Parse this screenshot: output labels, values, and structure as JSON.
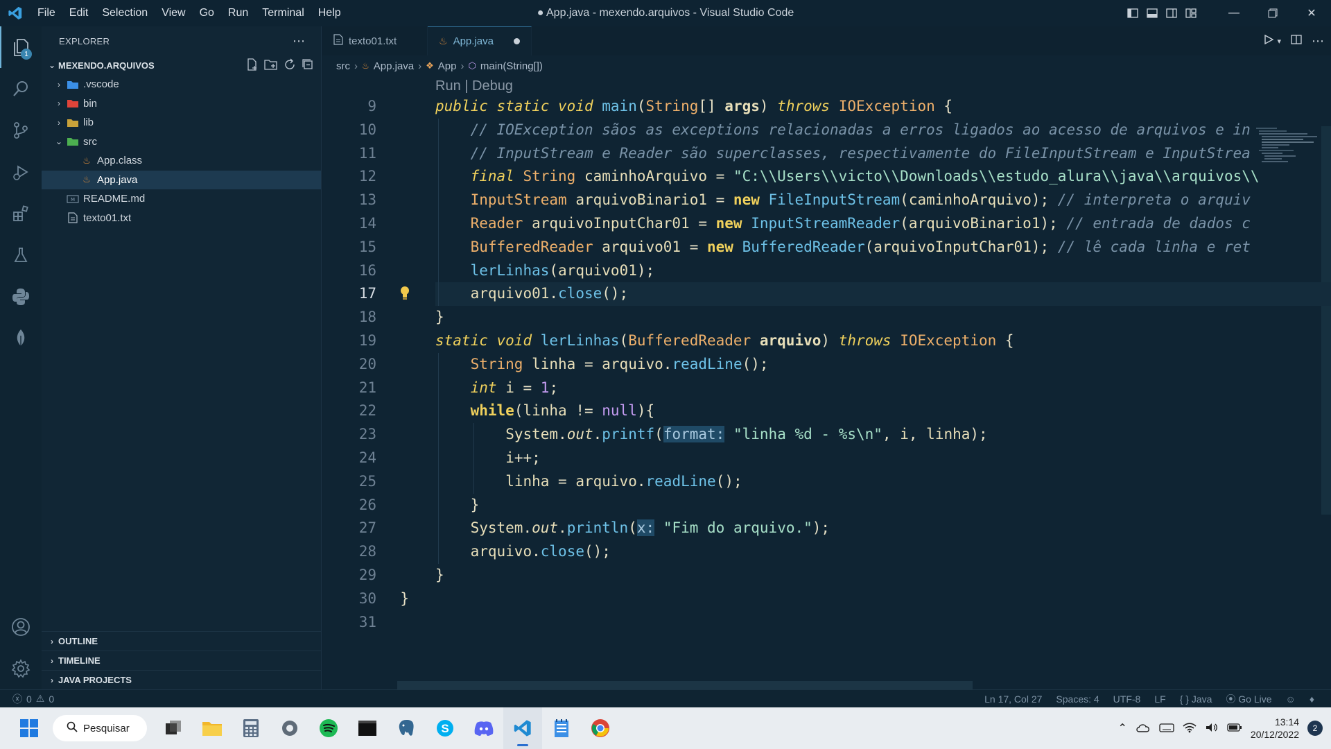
{
  "titlebar": {
    "menu": [
      "File",
      "Edit",
      "Selection",
      "View",
      "Go",
      "Run",
      "Terminal",
      "Help"
    ],
    "window_title": "● App.java - mexendo.arquivos - Visual Studio Code"
  },
  "activity": {
    "explorer_badge": "1"
  },
  "explorer": {
    "header": "EXPLORER",
    "project": "MEXENDO.ARQUIVOS",
    "items": [
      {
        "label": ".vscode",
        "icon": "folder-vscode-icon",
        "chevron": "›",
        "indent": 0
      },
      {
        "label": "bin",
        "icon": "folder-bin-icon",
        "chevron": "›",
        "indent": 0
      },
      {
        "label": "lib",
        "icon": "folder-lib-icon",
        "chevron": "›",
        "indent": 0
      },
      {
        "label": "src",
        "icon": "folder-src-icon",
        "chevron": "⌄",
        "indent": 0
      },
      {
        "label": "App.class",
        "icon": "java-file-icon",
        "chevron": "",
        "indent": 1
      },
      {
        "label": "App.java",
        "icon": "java-file-icon",
        "chevron": "",
        "indent": 1,
        "selected": true
      },
      {
        "label": "README.md",
        "icon": "markdown-file-icon",
        "chevron": "",
        "indent": 0
      },
      {
        "label": "texto01.txt",
        "icon": "text-file-icon",
        "chevron": "",
        "indent": 0
      }
    ],
    "bottom_sections": [
      "OUTLINE",
      "TIMELINE",
      "JAVA PROJECTS"
    ]
  },
  "tabs": [
    {
      "label": "texto01.txt",
      "active": false
    },
    {
      "label": "App.java",
      "active": true
    }
  ],
  "breadcrumb": [
    "src",
    "App.java",
    "App",
    "main(String[])"
  ],
  "editor": {
    "codelens": "Run | Debug",
    "current_line": "17",
    "lines": [
      {
        "n": "9",
        "indent": 1,
        "html": "<span class='kw'>public</span> <span class='kw'>static</span> <span class='kw'>void</span> <span class='fn'>main</span>(<span class='ty'>String</span>[] <span class='id bold'>args</span>) <span class='kw'>throws</span> <span class='ty'>IOException</span> {"
      },
      {
        "n": "10",
        "indent": 2,
        "html": "<span class='cm'>// IOException sãos as exceptions relacionadas a erros ligados ao acesso de arquivos e in</span>"
      },
      {
        "n": "11",
        "indent": 2,
        "html": "<span class='cm'>// InputStream e Reader são superclasses, respectivamente do FileInputStream e InputStrea</span>"
      },
      {
        "n": "12",
        "indent": 2,
        "html": "<span class='kw'>final</span> <span class='ty'>String</span> <span class='id'>caminhoArquivo</span> = <span class='str'>\"C:\\\\Users\\\\victo\\\\Downloads\\\\estudo_alura\\\\java\\\\arquivos\\\\</span>"
      },
      {
        "n": "13",
        "indent": 2,
        "html": "<span class='ty'>InputStream</span> <span class='id'>arquivoBinario1</span> = <span class='kw2'>new</span> <span class='fn'>FileInputStream</span>(<span class='id'>caminhoArquivo</span>); <span class='cm'>// interpreta o arquiv</span>"
      },
      {
        "n": "14",
        "indent": 2,
        "html": "<span class='ty'>Reader</span> <span class='id'>arquivoInputChar01</span> = <span class='kw2'>new</span> <span class='fn'>InputStreamReader</span>(<span class='id'>arquivoBinario1</span>); <span class='cm'>// entrada de dados c</span>"
      },
      {
        "n": "15",
        "indent": 2,
        "html": "<span class='ty'>BufferedReader</span> <span class='id'>arquivo01</span> = <span class='kw2'>new</span> <span class='fn'>BufferedReader</span>(<span class='id'>arquivoInputChar01</span>); <span class='cm'>// lê cada linha e ret</span>"
      },
      {
        "n": "16",
        "indent": 2,
        "html": "<span class='fn'>lerLinhas</span>(<span class='id'>arquivo01</span>);"
      },
      {
        "n": "17",
        "indent": 2,
        "html": "<span class='id'>arquivo01</span>.<span class='fn'>close</span>();"
      },
      {
        "n": "18",
        "indent": 1,
        "html": "}"
      },
      {
        "n": "19",
        "indent": 1,
        "html": "<span class='kw'>static</span> <span class='kw'>void</span> <span class='fn'>lerLinhas</span>(<span class='ty'>BufferedReader</span> <span class='id bold'>arquivo</span>) <span class='kw'>throws</span> <span class='ty'>IOException</span> {"
      },
      {
        "n": "20",
        "indent": 2,
        "html": "<span class='ty'>String</span> <span class='id'>linha</span> = <span class='id'>arquivo</span>.<span class='fn'>readLine</span>();"
      },
      {
        "n": "21",
        "indent": 2,
        "html": "<span class='kw'>int</span> <span class='id'>i</span> = <span class='num'>1</span>;"
      },
      {
        "n": "22",
        "indent": 2,
        "html": "<span class='kw2'>while</span>(<span class='id'>linha</span> != <span class='num'>null</span>){"
      },
      {
        "n": "23",
        "indent": 3,
        "html": "<span class='id'>System</span>.<span class='id it'>out</span>.<span class='fn'>printf</span>(<span class='hint'>format:</span> <span class='str'>\"linha %d - %s\\n\"</span>, <span class='id'>i</span>, <span class='id'>linha</span>);"
      },
      {
        "n": "24",
        "indent": 3,
        "html": "<span class='id'>i</span>++;"
      },
      {
        "n": "25",
        "indent": 3,
        "html": "<span class='id'>linha</span> = <span class='id'>arquivo</span>.<span class='fn'>readLine</span>();"
      },
      {
        "n": "26",
        "indent": 2,
        "html": "}"
      },
      {
        "n": "27",
        "indent": 2,
        "html": "<span class='id'>System</span>.<span class='id it'>out</span>.<span class='fn'>println</span>(<span class='hint'>x:</span> <span class='str'>\"Fim do arquivo.\"</span>);"
      },
      {
        "n": "28",
        "indent": 2,
        "html": "<span class='id'>arquivo</span>.<span class='fn'>close</span>();"
      },
      {
        "n": "29",
        "indent": 1,
        "html": "}"
      },
      {
        "n": "30",
        "indent": 0,
        "html": "}"
      },
      {
        "n": "31",
        "indent": 0,
        "html": ""
      }
    ]
  },
  "statusbar": {
    "errors": "0",
    "warnings": "0",
    "position": "Ln 17, Col 27",
    "spaces": "Spaces: 4",
    "encoding": "UTF-8",
    "eol": "LF",
    "language": "Java",
    "golive": "Go Live"
  },
  "taskbar": {
    "search_label": "Pesquisar",
    "time": "13:14",
    "date": "20/12/2022",
    "notifications": "2"
  },
  "colors": {
    "accent": "#6fb3d8",
    "editor_bg": "#0f2433",
    "keyword": "#f0d15c",
    "function": "#6ec2e8",
    "string": "#a7e0c8"
  }
}
